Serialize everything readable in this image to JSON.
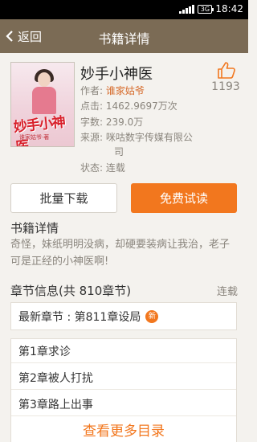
{
  "status_bar": {
    "network": "3G",
    "time": "18:42"
  },
  "header": {
    "back_label": "返回",
    "title": "书籍详情"
  },
  "book": {
    "cover_title": "妙手小神医",
    "cover_subtitle": "谁家姑爷·著",
    "title": "妙手小神医",
    "author_label": "作者:",
    "author": "谁家姑爷",
    "clicks": "点击: 1462.9697万次",
    "words": "字数: 239.0万",
    "source_line1": "来源: 咪咕数字传媒有限公",
    "source_line2": "司",
    "status": "状态: 连载",
    "likes": "1193"
  },
  "actions": {
    "batch_download": "批量下载",
    "free_trial": "免费试读"
  },
  "description": {
    "title": "书籍详情",
    "text": "奇怪，妹纸明明没病，却硬要装病让我治，老子可是正经的小神医啊!"
  },
  "chapters": {
    "title": "章节信息(共 810章节)",
    "status": "连载",
    "latest": "最新章节 : 第811章设局",
    "new_badge": "新",
    "list": [
      "第1章求诊",
      "第2章被人打扰",
      "第3章路上出事"
    ],
    "more": "查看更多目录"
  },
  "colors": {
    "header": "#7b6b55",
    "accent": "#f2771e",
    "background": "#f4f2ee"
  }
}
